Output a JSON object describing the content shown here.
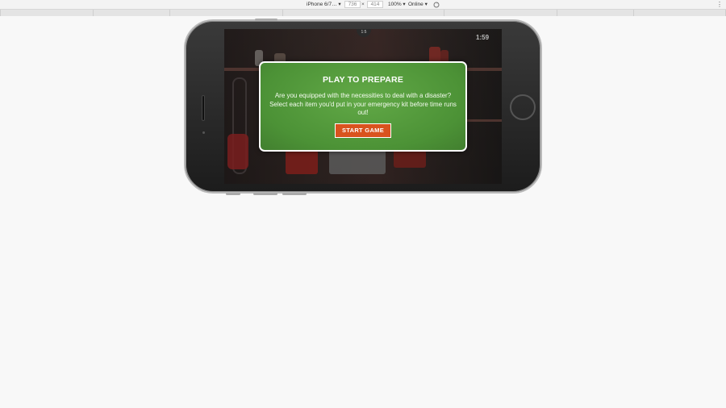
{
  "toolbar": {
    "device": "iPhone 6/7… ▾",
    "width": "736",
    "times": "×",
    "height": "414",
    "zoom": "100% ▾",
    "network": "Online ▾",
    "more": "⋮"
  },
  "screen": {
    "timer": "1:59",
    "clock": "1:5"
  },
  "modal": {
    "title": "PLAY TO PREPARE",
    "body": "Are you equipped with the necessities to deal with a disaster? Select each item you'd put in your emergency kit before time runs out!",
    "button_label": "START GAME"
  },
  "colors": {
    "modal_green": "#4f9a3a",
    "button_orange": "#d9531e",
    "phone_body": "#262626"
  }
}
